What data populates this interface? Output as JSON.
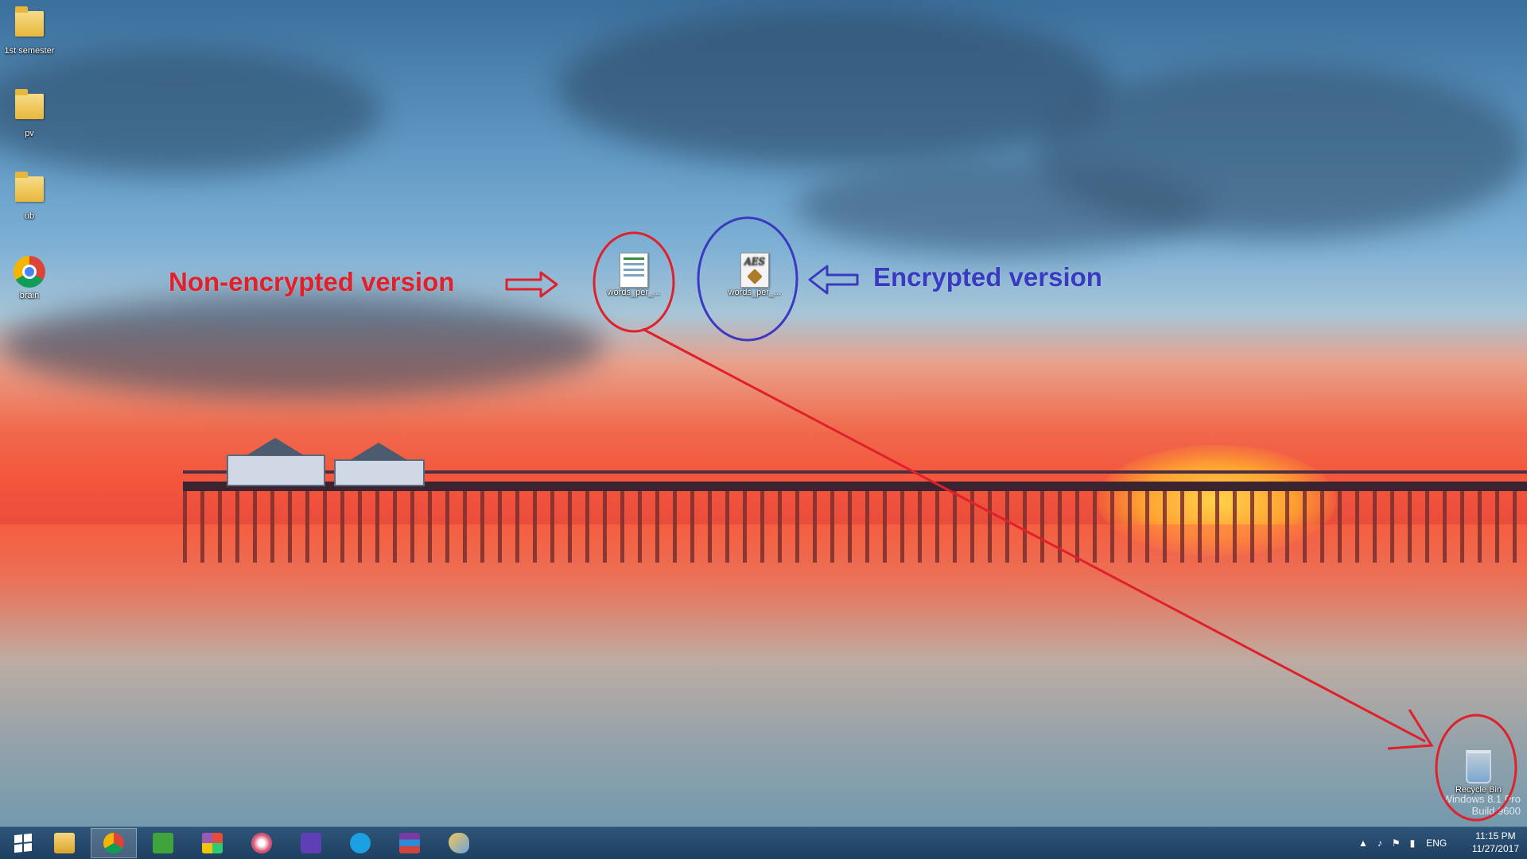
{
  "desktop": {
    "icons": [
      {
        "label": "1st semester",
        "icon": "folder-icon"
      },
      {
        "label": "pv",
        "icon": "folder-icon"
      },
      {
        "label": "ub",
        "icon": "folder-icon"
      },
      {
        "label": "brain",
        "icon": "chrome-icon"
      },
      {
        "label": "words_per_...",
        "icon": "document-icon"
      },
      {
        "label": "words_per_...",
        "icon": "aes-encrypted-file-icon"
      },
      {
        "label": "Recycle Bin",
        "icon": "recycle-bin-icon"
      }
    ],
    "watermark_lines": [
      "Windows 8.1 Pro",
      "Build 9600"
    ]
  },
  "annotations": {
    "left_label": "Non-encrypted version",
    "right_label": "Encrypted version",
    "colors": {
      "red": "#e0202a",
      "blue": "#3a3ac0"
    }
  },
  "taskbar": {
    "start": "windows-logo-icon",
    "pinned": [
      {
        "name": "file-explorer-icon",
        "active": false
      },
      {
        "name": "chrome-icon",
        "active": true
      },
      {
        "name": "evernote-icon",
        "active": false
      },
      {
        "name": "office-icon",
        "active": false
      },
      {
        "name": "paint-3d-icon",
        "active": false
      },
      {
        "name": "settings-gear-icon",
        "active": false
      },
      {
        "name": "skype-icon",
        "active": false
      },
      {
        "name": "winrar-icon",
        "active": false
      },
      {
        "name": "paint-icon",
        "active": false
      }
    ],
    "tray": {
      "language": "ENG",
      "time": "11:15 PM",
      "date": "11/27/2017"
    }
  }
}
